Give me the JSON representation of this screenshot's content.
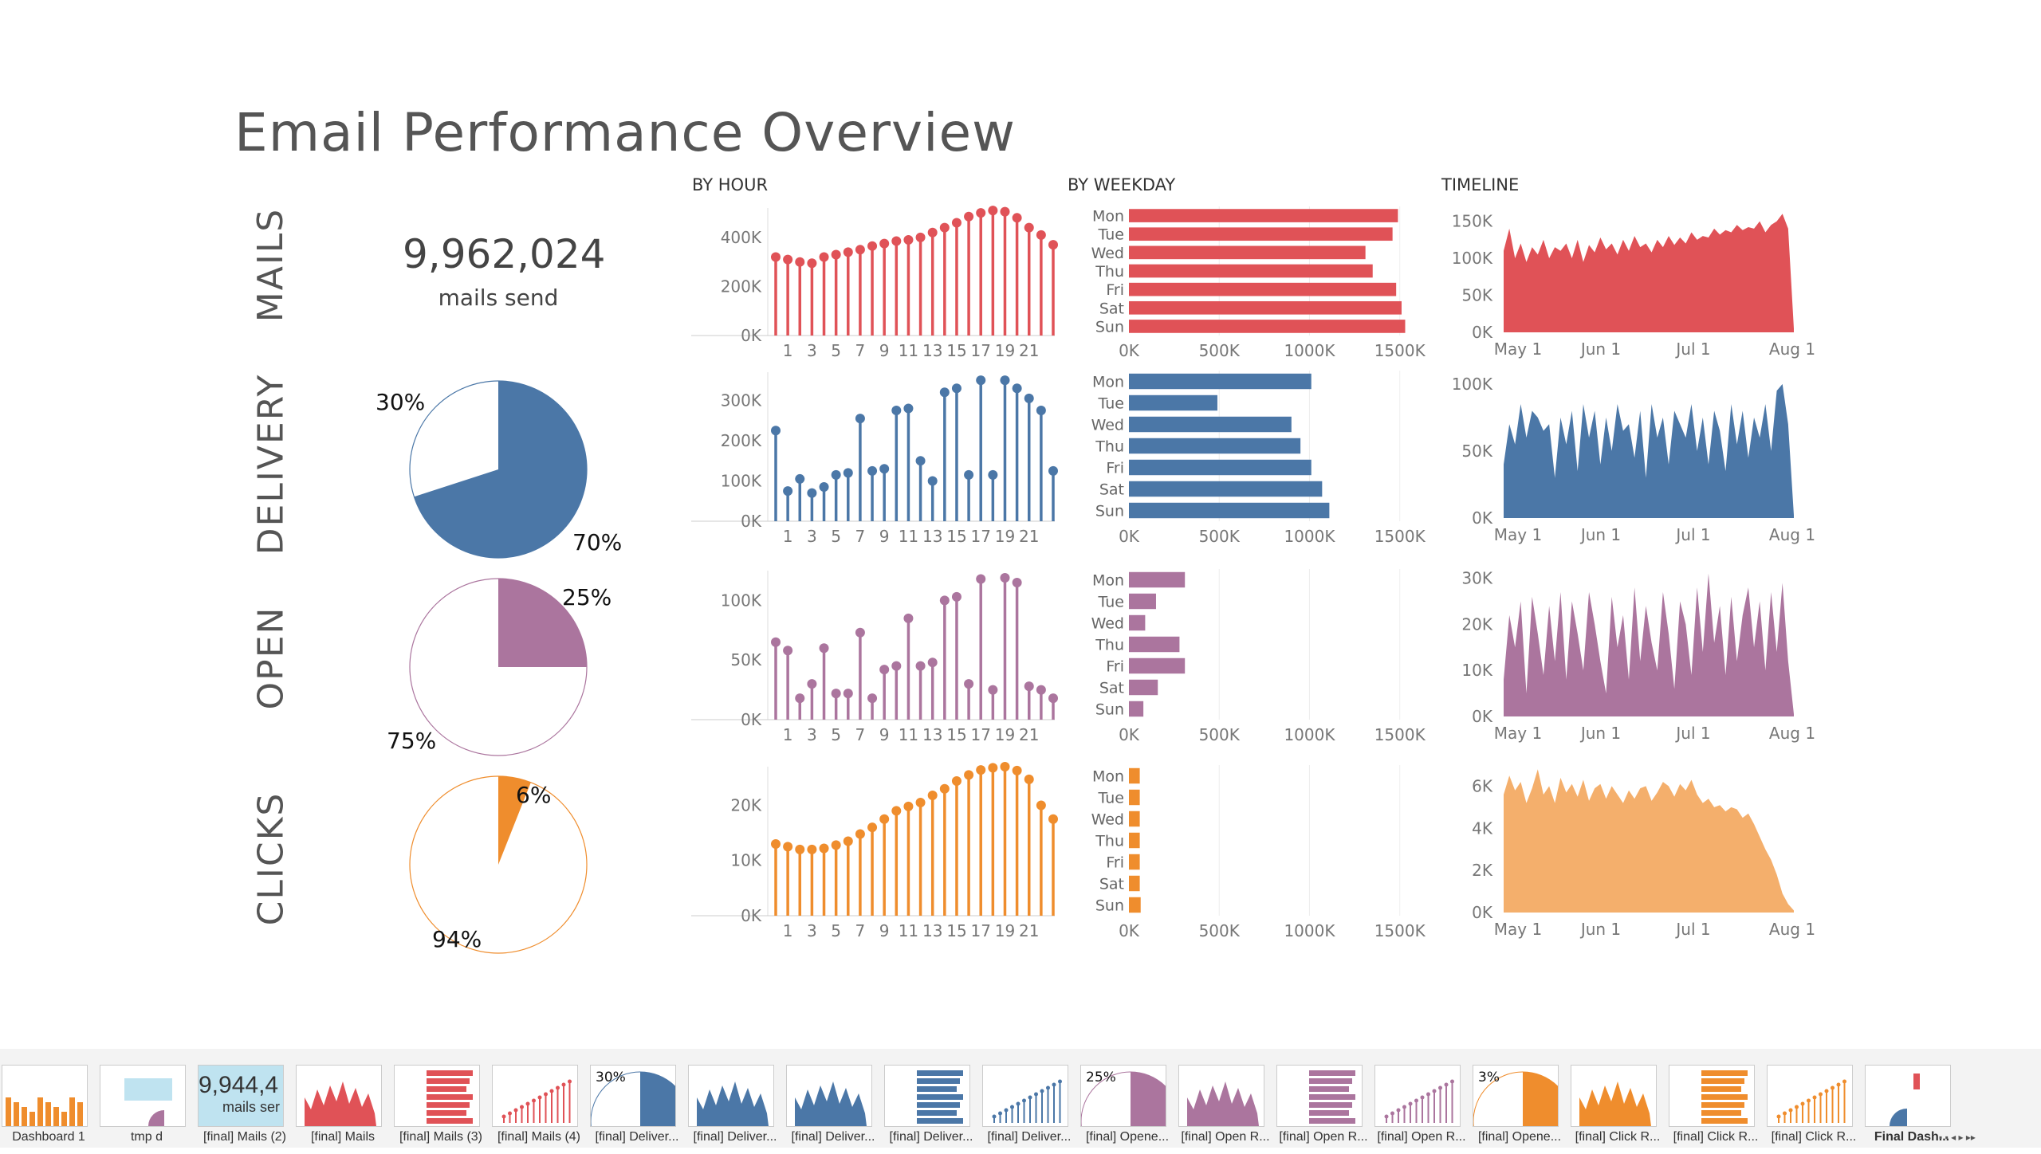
{
  "title": "Email Performance Overview",
  "sections": {
    "hour": "BY HOUR",
    "weekday": "BY WEEKDAY",
    "timeline": "TIMELINE"
  },
  "rows": [
    {
      "key": "mails",
      "label": "MAILS",
      "color": "#e05257"
    },
    {
      "key": "delivery",
      "label": "DELIVERY",
      "color": "#4b77a7"
    },
    {
      "key": "open",
      "label": "OPEN",
      "color": "#ab759e"
    },
    {
      "key": "clicks",
      "label": "CLICKS",
      "color": "#ef8d2d"
    }
  ],
  "mails_kpi": {
    "value": "9,962,024",
    "label": "mails send"
  },
  "pies": {
    "delivery": {
      "filled_pct": 70,
      "filled_label": "70%",
      "empty_label": "30%",
      "color": "#4b77a7"
    },
    "open": {
      "filled_pct": 25,
      "filled_label": "25%",
      "empty_label": "75%",
      "color": "#ab759e"
    },
    "clicks": {
      "filled_pct": 6,
      "filled_label": "6%",
      "empty_label": "94%",
      "color": "#ef8d2d"
    }
  },
  "chart_data": [
    {
      "type": "bar",
      "name": "mails-by-hour",
      "x": [
        0,
        1,
        2,
        3,
        4,
        5,
        6,
        7,
        8,
        9,
        10,
        11,
        12,
        13,
        14,
        15,
        16,
        17,
        18,
        19,
        20,
        21,
        22,
        23
      ],
      "xticks": [
        "1",
        "3",
        "5",
        "7",
        "9",
        "11",
        "13",
        "15",
        "17",
        "19",
        "21"
      ],
      "yticks": [
        "0K",
        "200K",
        "400K"
      ],
      "ytick_values": [
        0,
        200000,
        400000
      ],
      "ylim": [
        0,
        520000
      ],
      "values": [
        320000,
        310000,
        300000,
        295000,
        320000,
        330000,
        340000,
        350000,
        365000,
        375000,
        385000,
        390000,
        400000,
        420000,
        440000,
        460000,
        485000,
        500000,
        510000,
        505000,
        480000,
        440000,
        410000,
        370000
      ]
    },
    {
      "type": "barh",
      "name": "mails-by-weekday",
      "categories": [
        "Mon",
        "Tue",
        "Wed",
        "Thu",
        "Fri",
        "Sat",
        "Sun"
      ],
      "xticks": [
        "0K",
        "500K",
        "1000K",
        "1500K"
      ],
      "xtick_values": [
        0,
        500000,
        1000000,
        1500000
      ],
      "xlim": [
        0,
        1700000
      ],
      "values": [
        1490000,
        1460000,
        1310000,
        1350000,
        1480000,
        1510000,
        1530000
      ]
    },
    {
      "type": "area",
      "name": "mails-timeline",
      "xticks": [
        "May 1",
        "Jun 1",
        "Jul 1",
        "Aug 1"
      ],
      "yticks": [
        "0K",
        "50K",
        "100K",
        "150K"
      ],
      "ytick_values": [
        0,
        50000,
        100000,
        150000
      ],
      "ylim": [
        0,
        170000
      ],
      "values": [
        110000,
        140000,
        100000,
        120000,
        95000,
        115000,
        105000,
        125000,
        100000,
        115000,
        110000,
        120000,
        100000,
        125000,
        95000,
        118000,
        108000,
        128000,
        112000,
        120000,
        105000,
        125000,
        110000,
        130000,
        115000,
        120000,
        108000,
        125000,
        115000,
        130000,
        118000,
        128000,
        120000,
        135000,
        125000,
        130000,
        128000,
        140000,
        132000,
        138000,
        135000,
        145000,
        138000,
        142000,
        140000,
        150000,
        135000,
        145000,
        150000,
        160000,
        140000,
        5000
      ]
    },
    {
      "type": "bar",
      "name": "delivery-by-hour",
      "x": [
        0,
        1,
        2,
        3,
        4,
        5,
        6,
        7,
        8,
        9,
        10,
        11,
        12,
        13,
        14,
        15,
        16,
        17,
        18,
        19,
        20,
        21,
        22,
        23
      ],
      "xticks": [
        "1",
        "3",
        "5",
        "7",
        "9",
        "11",
        "13",
        "15",
        "17",
        "19",
        "21"
      ],
      "yticks": [
        "0K",
        "100K",
        "200K",
        "300K"
      ],
      "ytick_values": [
        0,
        100000,
        200000,
        300000
      ],
      "ylim": [
        0,
        370000
      ],
      "values": [
        225000,
        75000,
        105000,
        70000,
        85000,
        115000,
        120000,
        255000,
        125000,
        130000,
        275000,
        280000,
        150000,
        100000,
        320000,
        330000,
        115000,
        350000,
        115000,
        350000,
        330000,
        305000,
        275000,
        125000
      ]
    },
    {
      "type": "barh",
      "name": "delivery-by-weekday",
      "categories": [
        "Mon",
        "Tue",
        "Wed",
        "Thu",
        "Fri",
        "Sat",
        "Sun"
      ],
      "xticks": [
        "0K",
        "500K",
        "1000K",
        "1500K"
      ],
      "xtick_values": [
        0,
        500000,
        1000000,
        1500000
      ],
      "xlim": [
        0,
        1700000
      ],
      "values": [
        1010000,
        490000,
        900000,
        950000,
        1010000,
        1070000,
        1110000
      ]
    },
    {
      "type": "area",
      "name": "delivery-timeline",
      "xticks": [
        "May 1",
        "Jun 1",
        "Jul 1",
        "Aug 1"
      ],
      "yticks": [
        "0K",
        "50K",
        "100K"
      ],
      "ytick_values": [
        0,
        50000,
        100000
      ],
      "ylim": [
        0,
        110000
      ],
      "values": [
        40000,
        70000,
        55000,
        85000,
        60000,
        80000,
        75000,
        65000,
        70000,
        30000,
        75000,
        55000,
        80000,
        35000,
        85000,
        60000,
        80000,
        40000,
        75000,
        50000,
        85000,
        65000,
        70000,
        45000,
        80000,
        30000,
        85000,
        60000,
        75000,
        40000,
        80000,
        70000,
        60000,
        85000,
        50000,
        75000,
        40000,
        80000,
        65000,
        35000,
        85000,
        55000,
        80000,
        45000,
        75000,
        60000,
        85000,
        50000,
        95000,
        100000,
        70000,
        2000
      ]
    },
    {
      "type": "bar",
      "name": "open-by-hour",
      "x": [
        0,
        1,
        2,
        3,
        4,
        5,
        6,
        7,
        8,
        9,
        10,
        11,
        12,
        13,
        14,
        15,
        16,
        17,
        18,
        19,
        20,
        21,
        22,
        23
      ],
      "xticks": [
        "1",
        "3",
        "5",
        "7",
        "9",
        "11",
        "13",
        "15",
        "17",
        "19",
        "21"
      ],
      "yticks": [
        "0K",
        "50K",
        "100K"
      ],
      "ytick_values": [
        0,
        50000,
        100000
      ],
      "ylim": [
        0,
        125000
      ],
      "values": [
        65000,
        58000,
        18000,
        30000,
        60000,
        22000,
        22000,
        73000,
        18000,
        42000,
        45000,
        85000,
        45000,
        48000,
        100000,
        103000,
        30000,
        118000,
        25000,
        119000,
        115000,
        28000,
        25000,
        18000
      ]
    },
    {
      "type": "barh",
      "name": "open-by-weekday",
      "categories": [
        "Mon",
        "Tue",
        "Wed",
        "Thu",
        "Fri",
        "Sat",
        "Sun"
      ],
      "xticks": [
        "0K",
        "500K",
        "1000K",
        "1500K"
      ],
      "xtick_values": [
        0,
        500000,
        1000000,
        1500000
      ],
      "xlim": [
        0,
        1700000
      ],
      "values": [
        310000,
        150000,
        90000,
        280000,
        310000,
        160000,
        80000
      ]
    },
    {
      "type": "area",
      "name": "open-timeline",
      "xticks": [
        "May 1",
        "Jun 1",
        "Jul 1",
        "Aug 1"
      ],
      "yticks": [
        "0K",
        "10K",
        "20K",
        "30K"
      ],
      "ytick_values": [
        0,
        10000,
        20000,
        30000
      ],
      "ylim": [
        0,
        32000
      ],
      "values": [
        8000,
        22000,
        15000,
        25000,
        5000,
        26000,
        18000,
        9000,
        24000,
        12000,
        27000,
        8000,
        25000,
        18000,
        10000,
        27000,
        20000,
        12000,
        5000,
        26000,
        15000,
        22000,
        8000,
        28000,
        12000,
        24000,
        16000,
        10000,
        27000,
        18000,
        6000,
        25000,
        20000,
        9000,
        28000,
        14000,
        31000,
        16000,
        24000,
        9000,
        26000,
        12000,
        22000,
        28000,
        15000,
        25000,
        10000,
        27000,
        14000,
        29000,
        12000,
        500
      ]
    },
    {
      "type": "bar",
      "name": "clicks-by-hour",
      "x": [
        0,
        1,
        2,
        3,
        4,
        5,
        6,
        7,
        8,
        9,
        10,
        11,
        12,
        13,
        14,
        15,
        16,
        17,
        18,
        19,
        20,
        21,
        22,
        23
      ],
      "xticks": [
        "1",
        "3",
        "5",
        "7",
        "9",
        "11",
        "13",
        "15",
        "17",
        "19",
        "21"
      ],
      "yticks": [
        "0K",
        "10K",
        "20K"
      ],
      "ytick_values": [
        0,
        10000,
        20000
      ],
      "ylim": [
        0,
        27000
      ],
      "values": [
        13000,
        12500,
        12000,
        12000,
        12200,
        12800,
        13500,
        14800,
        16000,
        17500,
        19000,
        19800,
        20500,
        21800,
        23000,
        24400,
        25500,
        26400,
        26800,
        27000,
        26300,
        24700,
        20000,
        17500
      ]
    },
    {
      "type": "barh",
      "name": "clicks-by-weekday",
      "categories": [
        "Mon",
        "Tue",
        "Wed",
        "Thu",
        "Fri",
        "Sat",
        "Sun"
      ],
      "xticks": [
        "0K",
        "500K",
        "1000K",
        "1500K"
      ],
      "xtick_values": [
        0,
        500000,
        1000000,
        1500000
      ],
      "xlim": [
        0,
        1700000
      ],
      "values": [
        60000,
        60000,
        60000,
        60000,
        60000,
        60000,
        65000
      ]
    },
    {
      "type": "area",
      "name": "clicks-timeline",
      "xticks": [
        "May 1",
        "Jun 1",
        "Jul 1",
        "Aug 1"
      ],
      "yticks": [
        "0K",
        "2K",
        "4K",
        "6K"
      ],
      "ytick_values": [
        0,
        2000,
        4000,
        6000
      ],
      "ylim": [
        0,
        7000
      ],
      "values": [
        5600,
        6500,
        5800,
        6200,
        5200,
        5900,
        6800,
        5600,
        6000,
        5200,
        6400,
        5700,
        6100,
        5500,
        6300,
        5300,
        5900,
        6100,
        5400,
        6000,
        5600,
        5200,
        5800,
        5400,
        5900,
        6000,
        5300,
        5700,
        6200,
        6000,
        5500,
        6100,
        5800,
        6300,
        5600,
        5200,
        5400,
        5000,
        5100,
        4800,
        5000,
        4900,
        4500,
        4700,
        4200,
        3600,
        3000,
        2500,
        1800,
        900,
        400,
        100
      ]
    }
  ],
  "tabs": [
    {
      "label": "Dashboard 1",
      "thumb": "orange-bars"
    },
    {
      "label": "tmp d",
      "thumb": "mini-dashboard"
    },
    {
      "label": "[final] Mails (2)",
      "thumb": "kpi",
      "text": "9,944,4",
      "sub": "mails ser"
    },
    {
      "label": "[final] Mails",
      "thumb": "red-area"
    },
    {
      "label": "[final] Mails (3)",
      "thumb": "red-hbars"
    },
    {
      "label": "[final] Mails (4)",
      "thumb": "red-lollipop"
    },
    {
      "label": "[final] Deliver...",
      "thumb": "blue-pie",
      "text": "30%"
    },
    {
      "label": "[final] Deliver...",
      "thumb": "blue-area"
    },
    {
      "label": "[final] Deliver...",
      "thumb": "blue-area2"
    },
    {
      "label": "[final] Deliver...",
      "thumb": "blue-hbars"
    },
    {
      "label": "[final] Deliver...",
      "thumb": "blue-lollipop"
    },
    {
      "label": "[final] Opene...",
      "thumb": "purple-pie",
      "text": "25%"
    },
    {
      "label": "[final] Open R...",
      "thumb": "purple-area"
    },
    {
      "label": "[final] Open R...",
      "thumb": "purple-hbars"
    },
    {
      "label": "[final] Open R...",
      "thumb": "purple-lollipop"
    },
    {
      "label": "[final] Opene...",
      "thumb": "orange-pie",
      "text": "3%"
    },
    {
      "label": "[final] Click R...",
      "thumb": "orange-area"
    },
    {
      "label": "[final] Click R...",
      "thumb": "orange-hbars"
    },
    {
      "label": "[final] Click R...",
      "thumb": "orange-lollipop"
    },
    {
      "label": "Final Dash...",
      "thumb": "final",
      "active": true
    }
  ]
}
